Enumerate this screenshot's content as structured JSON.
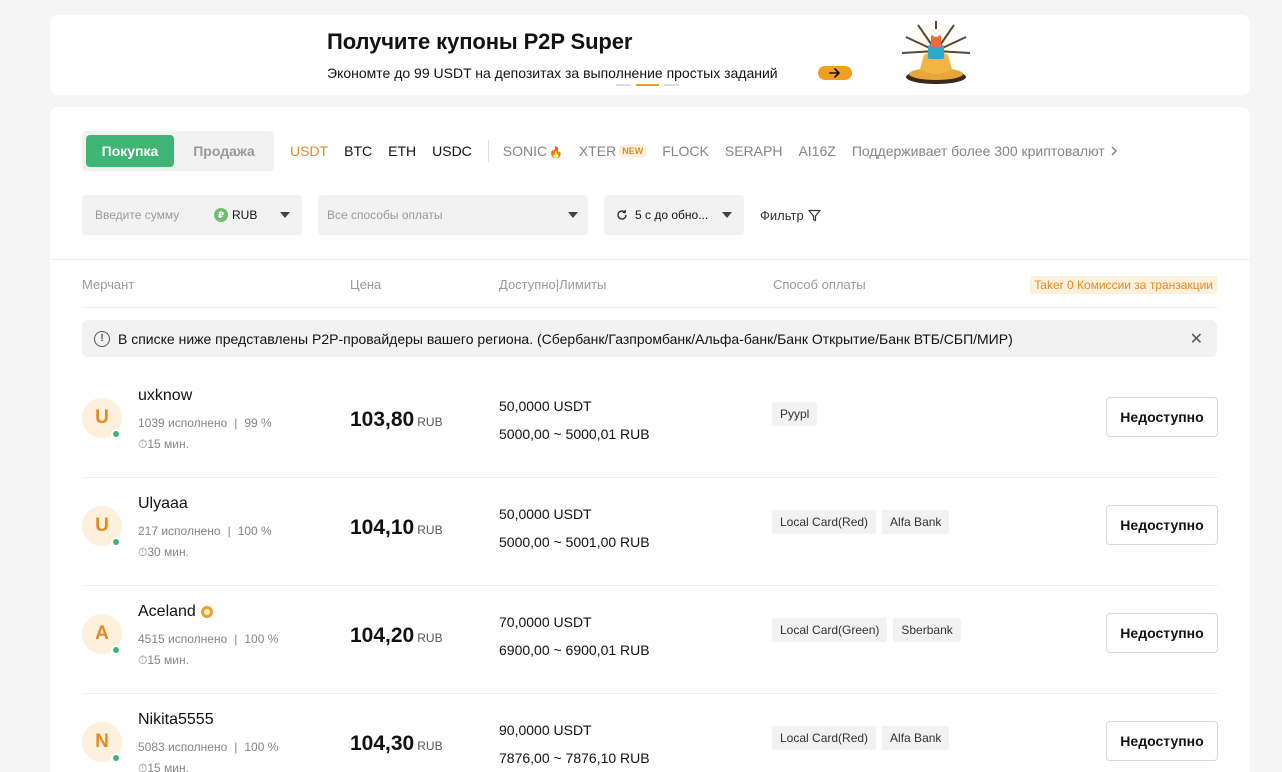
{
  "banner": {
    "title": "Получите купоны P2P Super",
    "subtitle": "Экономте до 99 USDT на депозитах за выполнение простых заданий"
  },
  "trade": {
    "buy_label": "Покупка",
    "sell_label": "Продажа"
  },
  "coins": {
    "usdt": "USDT",
    "btc": "BTC",
    "eth": "ETH",
    "usdc": "USDC",
    "sonic": "SONIC",
    "xter": "XTER",
    "xter_badge": "NEW",
    "flock": "FLOCK",
    "seraph": "SERAPH",
    "ai16z": "AI16Z",
    "more": "Поддерживает более 300 криптовалют"
  },
  "filters": {
    "amount_placeholder": "Введите сумму",
    "currency_icon": "₽",
    "currency": "RUB",
    "payment_placeholder": "Все способы оплаты",
    "refresh_label": "5 с до обно...",
    "filter_label": "Фильтр"
  },
  "table": {
    "headers": {
      "merchant": "Мерчант",
      "price": "Цена",
      "available": "Доступно|Лимиты",
      "payment": "Способ оплаты"
    },
    "taker_badge": "Taker 0 Комиссии за транзакции"
  },
  "notice": {
    "text": "В списке ниже представлены P2P-провайдеры вашего региона. (Сбербанк/Газпромбанк/Альфа-банк/Банк Открытие/Банк ВТБ/СБП/МИР)"
  },
  "rows": [
    {
      "initial": "U",
      "name": "uxknow",
      "orders": "1039 исполнено",
      "completion": "99 %",
      "time": "15 мин.",
      "price": "103,80",
      "price_currency": "RUB",
      "available": "50,0000 USDT",
      "limits": "5000,00 ~ 5000,01 RUB",
      "methods": [
        "Pyypl"
      ],
      "action": "Недоступно"
    },
    {
      "initial": "U",
      "name": "Ulyaaa",
      "orders": "217 исполнено",
      "completion": "100 %",
      "time": "30 мин.",
      "price": "104,10",
      "price_currency": "RUB",
      "available": "50,0000 USDT",
      "limits": "5000,00 ~ 5001,00 RUB",
      "methods": [
        "Local Card(Red)",
        "Alfa Bank"
      ],
      "action": "Недоступно"
    },
    {
      "initial": "A",
      "name": "Aceland",
      "orders": "4515 исполнено",
      "completion": "100 %",
      "time": "15 мин.",
      "price": "104,20",
      "price_currency": "RUB",
      "available": "70,0000 USDT",
      "limits": "6900,00 ~ 6900,01 RUB",
      "methods": [
        "Local Card(Green)",
        "Sberbank"
      ],
      "action": "Недоступно"
    },
    {
      "initial": "N",
      "name": "Nikita5555",
      "orders": "5083 исполнено",
      "completion": "100 %",
      "time": "15 мин.",
      "price": "104,30",
      "price_currency": "RUB",
      "available": "90,0000 USDT",
      "limits": "7876,00 ~ 7876,10 RUB",
      "methods": [
        "Local Card(Red)",
        "Alfa Bank"
      ],
      "action": "Недоступно"
    }
  ],
  "colors": {
    "buy": "#3eb574",
    "accent": "#e58a1f",
    "online": "#3eb574"
  }
}
